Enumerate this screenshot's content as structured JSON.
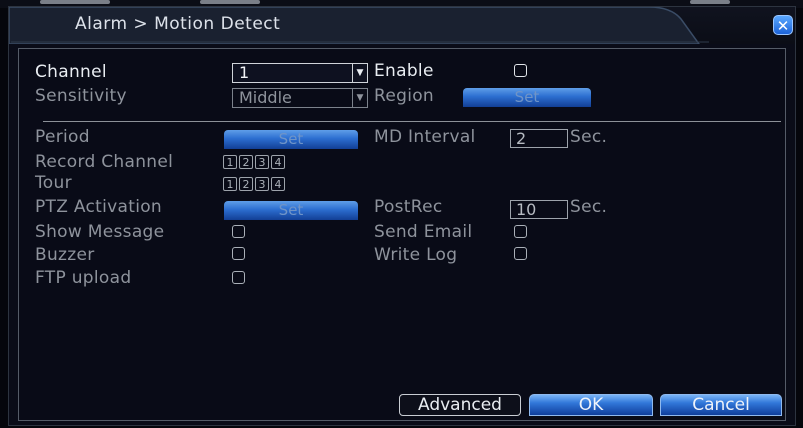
{
  "window": {
    "title": "Alarm > Motion Detect",
    "close_glyph": "✕"
  },
  "form": {
    "channel_label": "Channel",
    "channel_value": "1",
    "enable_label": "Enable",
    "sensitivity_label": "Sensitivity",
    "sensitivity_value": "Middle",
    "region_label": "Region",
    "region_button": "Set",
    "period_label": "Period",
    "period_button": "Set",
    "md_interval_label": "MD Interval",
    "md_interval_value": "2",
    "md_interval_unit": "Sec.",
    "record_channel_label": "Record Channel",
    "record_channels": [
      "1",
      "2",
      "3",
      "4"
    ],
    "tour_label": "Tour",
    "tour_channels": [
      "1",
      "2",
      "3",
      "4"
    ],
    "ptz_label": "PTZ Activation",
    "ptz_button": "Set",
    "postrec_label": "PostRec",
    "postrec_value": "10",
    "postrec_unit": "Sec.",
    "show_message_label": "Show Message",
    "send_email_label": "Send Email",
    "buzzer_label": "Buzzer",
    "write_log_label": "Write Log",
    "ftp_upload_label": "FTP upload"
  },
  "buttons": {
    "advanced": "Advanced",
    "ok": "OK",
    "cancel": "Cancel"
  },
  "colors": {
    "accent": "#2c6ed0",
    "title_tab": "#3a4c66"
  },
  "icons": {
    "close": "close-icon",
    "dropdown": "chevron-down-icon",
    "cursor": "mouse-pointer-icon"
  }
}
